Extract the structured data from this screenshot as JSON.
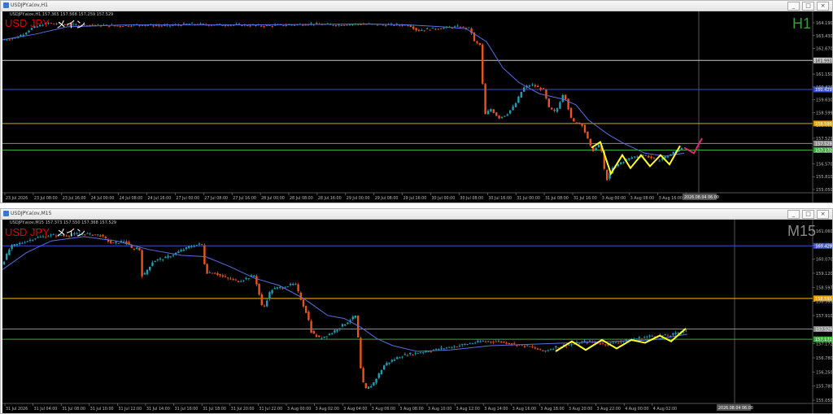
{
  "colors": {
    "background": "#000000",
    "bull": "#1f9fb5",
    "bear": "#e8541c",
    "ma": "#5a6fe0",
    "zigzag": "#ffff2a",
    "forecast": "#e0287a",
    "line_white": "#c8c8c8",
    "line_blue": "#3a4fd0",
    "line_orange": "#e8a000",
    "line_green": "#3aaa3a",
    "symbol": "#e00000",
    "tf_h1": "#3a9a3a",
    "tf_m15": "#8a8a8a"
  },
  "window_buttons": [
    "_",
    "□",
    "×"
  ],
  "top": {
    "window_title": "USDJPY.a(ov,H1",
    "ohlc": "USDJPY.a(ov,H1  157.365 157.568 157.259 157.529",
    "symbol_label": "USD JPY",
    "mode_label": "メイン",
    "timeframe": "H1",
    "price_labels": [
      "164.190",
      "163.430",
      "162.670",
      "161.991",
      "161.150",
      "160.429",
      "159.630",
      "158.599",
      "158.090",
      "157.529",
      "157.172",
      "156.570",
      "155.810",
      "155.050"
    ],
    "time_labels": [
      "23 Jul 2026",
      "23 Jul 08:00",
      "23 Jul 16:00",
      "24 Jul 00:00",
      "24 Jul 08:00",
      "24 Jul 16:00",
      "27 Jul 00:00",
      "27 Jul 08:00",
      "27 Jul 16:00",
      "28 Jul 00:00",
      "28 Jul 08:00",
      "28 Jul 16:00",
      "29 Jul 00:00",
      "29 Jul 08:00",
      "29 Jul 16:00",
      "30 Jul 00:00",
      "30 Jul 08:00",
      "30 Jul 16:00",
      "31 Jul 00:00",
      "31 Jul 08:00",
      "31 Jul 16:00",
      "3 Aug 00:00",
      "3 Aug 08:00",
      "3 Aug 16:00",
      "4 Aug 00:00"
    ],
    "cursor_time": "2026.08.04 06:00",
    "chart_data": {
      "type": "candlestick",
      "ylim": [
        155.05,
        164.19
      ],
      "levels": {
        "white": 161.991,
        "blue": 160.429,
        "orange": 158.599,
        "gray": 157.529,
        "green": 157.172
      },
      "price_path": [
        [
          0,
          163.1
        ],
        [
          15,
          163.2
        ],
        [
          25,
          163.4
        ],
        [
          35,
          163.7
        ],
        [
          55,
          164.0
        ],
        [
          80,
          163.9
        ],
        [
          110,
          163.9
        ],
        [
          140,
          163.85
        ],
        [
          170,
          163.9
        ],
        [
          200,
          163.85
        ],
        [
          230,
          163.95
        ],
        [
          260,
          163.9
        ],
        [
          290,
          163.9
        ],
        [
          320,
          163.85
        ],
        [
          350,
          163.9
        ],
        [
          380,
          163.95
        ],
        [
          410,
          163.9
        ],
        [
          440,
          163.95
        ],
        [
          470,
          163.9
        ],
        [
          500,
          163.9
        ],
        [
          510,
          163.6
        ],
        [
          530,
          163.7
        ],
        [
          560,
          163.8
        ],
        [
          575,
          163.7
        ],
        [
          580,
          163.0
        ],
        [
          588,
          162.8
        ],
        [
          592,
          159.0
        ],
        [
          600,
          159.4
        ],
        [
          610,
          158.9
        ],
        [
          620,
          159.1
        ],
        [
          630,
          159.6
        ],
        [
          640,
          160.5
        ],
        [
          650,
          160.7
        ],
        [
          665,
          160.4
        ],
        [
          672,
          159.4
        ],
        [
          680,
          159.2
        ],
        [
          690,
          160.3
        ],
        [
          700,
          158.7
        ],
        [
          712,
          158.6
        ],
        [
          725,
          157.1
        ],
        [
          735,
          157.5
        ],
        [
          742,
          155.5
        ],
        [
          750,
          156.2
        ],
        [
          760,
          156.5
        ],
        [
          775,
          156.8
        ],
        [
          790,
          156.9
        ],
        [
          805,
          156.6
        ],
        [
          820,
          156.9
        ],
        [
          835,
          157.3
        ],
        [
          838,
          157.5
        ]
      ],
      "ma_path": [
        [
          0,
          163.1
        ],
        [
          40,
          163.4
        ],
        [
          80,
          163.8
        ],
        [
          150,
          163.9
        ],
        [
          300,
          163.9
        ],
        [
          450,
          163.95
        ],
        [
          500,
          163.9
        ],
        [
          540,
          163.8
        ],
        [
          570,
          163.7
        ],
        [
          595,
          163.0
        ],
        [
          615,
          161.6
        ],
        [
          635,
          160.8
        ],
        [
          660,
          160.2
        ],
        [
          690,
          159.9
        ],
        [
          705,
          159.6
        ],
        [
          720,
          158.8
        ],
        [
          745,
          158.0
        ],
        [
          765,
          157.5
        ],
        [
          790,
          157.0
        ],
        [
          815,
          156.85
        ],
        [
          838,
          157.0
        ]
      ],
      "zigzag": [
        [
          724,
          157.3
        ],
        [
          735,
          157.6
        ],
        [
          748,
          155.9
        ],
        [
          762,
          156.9
        ],
        [
          772,
          156.2
        ],
        [
          785,
          156.9
        ],
        [
          796,
          156.3
        ],
        [
          809,
          156.9
        ],
        [
          820,
          156.4
        ],
        [
          833,
          157.4
        ]
      ],
      "forecast": [
        [
          838,
          157.3
        ],
        [
          850,
          157.0
        ],
        [
          860,
          157.8
        ]
      ]
    }
  },
  "bottom": {
    "window_title": "USDJPY.a(ov,M15",
    "ohlc": "USDJPY.a(ov,M15  157.373 157.550 157.368 157.529",
    "symbol_label": "USD JPY",
    "mode_label": "メイン",
    "timeframe": "M15",
    "price_labels": [
      "161.060",
      "160.429",
      "160.070",
      "159.120",
      "158.597",
      "158.595",
      "157.910",
      "157.529",
      "157.172",
      "156.780",
      "156.250",
      "155.780",
      "155.050"
    ],
    "time_labels": [
      "31 Jul 2026",
      "31 Jul 04:00",
      "31 Jul 08:00",
      "31 Jul 10:00",
      "31 Jul 12:00",
      "31 Jul 14:00",
      "31 Jul 16:00",
      "31 Jul 18:00",
      "31 Jul 20:00",
      "31 Jul 22:00",
      "3 Aug 00:00",
      "3 Aug 02:00",
      "3 Aug 04:00",
      "3 Aug 06:00",
      "3 Aug 08:00",
      "3 Aug 10:00",
      "3 Aug 12:00",
      "3 Aug 14:00",
      "3 Aug 16:00",
      "3 Aug 18:00",
      "3 Aug 20:00",
      "3 Aug 22:00",
      "4 Aug 00:00",
      "4 Aug 02:00"
    ],
    "cursor_time": "2026.08.04 06:00",
    "chart_data": {
      "type": "candlestick",
      "ylim": [
        155.05,
        161.06
      ],
      "levels": {
        "blue": 160.429,
        "white": 158.597,
        "orange": 158.595,
        "gray": 157.529,
        "green": 157.172
      },
      "price_path": [
        [
          0,
          159.8
        ],
        [
          10,
          160.4
        ],
        [
          20,
          160.5
        ],
        [
          40,
          160.7
        ],
        [
          60,
          160.8
        ],
        [
          80,
          160.8
        ],
        [
          100,
          160.85
        ],
        [
          120,
          160.8
        ],
        [
          135,
          160.5
        ],
        [
          150,
          160.6
        ],
        [
          160,
          160.3
        ],
        [
          168,
          160.4
        ],
        [
          172,
          159.3
        ],
        [
          178,
          159.6
        ],
        [
          185,
          159.9
        ],
        [
          200,
          160.0
        ],
        [
          215,
          160.2
        ],
        [
          230,
          160.4
        ],
        [
          245,
          160.5
        ],
        [
          250,
          159.5
        ],
        [
          260,
          159.5
        ],
        [
          275,
          159.3
        ],
        [
          290,
          159.2
        ],
        [
          310,
          159.4
        ],
        [
          320,
          158.2
        ],
        [
          330,
          158.9
        ],
        [
          345,
          159.0
        ],
        [
          360,
          159.1
        ],
        [
          365,
          158.7
        ],
        [
          375,
          158.0
        ],
        [
          380,
          157.4
        ],
        [
          390,
          157.2
        ],
        [
          405,
          157.4
        ],
        [
          415,
          157.6
        ],
        [
          425,
          157.8
        ],
        [
          435,
          158.0
        ],
        [
          440,
          156.2
        ],
        [
          445,
          155.4
        ],
        [
          455,
          155.6
        ],
        [
          470,
          156.3
        ],
        [
          490,
          156.6
        ],
        [
          510,
          156.7
        ],
        [
          530,
          156.8
        ],
        [
          550,
          156.9
        ],
        [
          570,
          157.0
        ],
        [
          590,
          157.1
        ],
        [
          610,
          157.1
        ],
        [
          630,
          157.0
        ],
        [
          650,
          156.9
        ],
        [
          665,
          156.75
        ],
        [
          680,
          156.9
        ],
        [
          700,
          157.0
        ],
        [
          720,
          157.1
        ],
        [
          740,
          157.0
        ],
        [
          760,
          157.1
        ],
        [
          780,
          157.2
        ],
        [
          800,
          157.3
        ],
        [
          820,
          157.3
        ],
        [
          842,
          157.5
        ]
      ],
      "ma_path": [
        [
          0,
          159.6
        ],
        [
          30,
          160.2
        ],
        [
          60,
          160.6
        ],
        [
          100,
          160.75
        ],
        [
          140,
          160.6
        ],
        [
          180,
          160.3
        ],
        [
          220,
          160.1
        ],
        [
          250,
          160.05
        ],
        [
          280,
          159.7
        ],
        [
          310,
          159.3
        ],
        [
          340,
          159.05
        ],
        [
          370,
          158.6
        ],
        [
          400,
          158.0
        ],
        [
          420,
          157.9
        ],
        [
          440,
          157.6
        ],
        [
          460,
          157.2
        ],
        [
          480,
          156.95
        ],
        [
          510,
          156.75
        ],
        [
          550,
          156.8
        ],
        [
          600,
          156.95
        ],
        [
          650,
          157.0
        ],
        [
          700,
          157.05
        ],
        [
          750,
          157.1
        ],
        [
          800,
          157.15
        ],
        [
          842,
          157.35
        ]
      ],
      "zigzag": [
        [
          680,
          156.75
        ],
        [
          700,
          157.1
        ],
        [
          717,
          156.8
        ],
        [
          737,
          157.15
        ],
        [
          755,
          156.85
        ],
        [
          773,
          157.15
        ],
        [
          790,
          157.05
        ],
        [
          808,
          157.3
        ],
        [
          822,
          157.1
        ],
        [
          840,
          157.55
        ]
      ]
    }
  }
}
